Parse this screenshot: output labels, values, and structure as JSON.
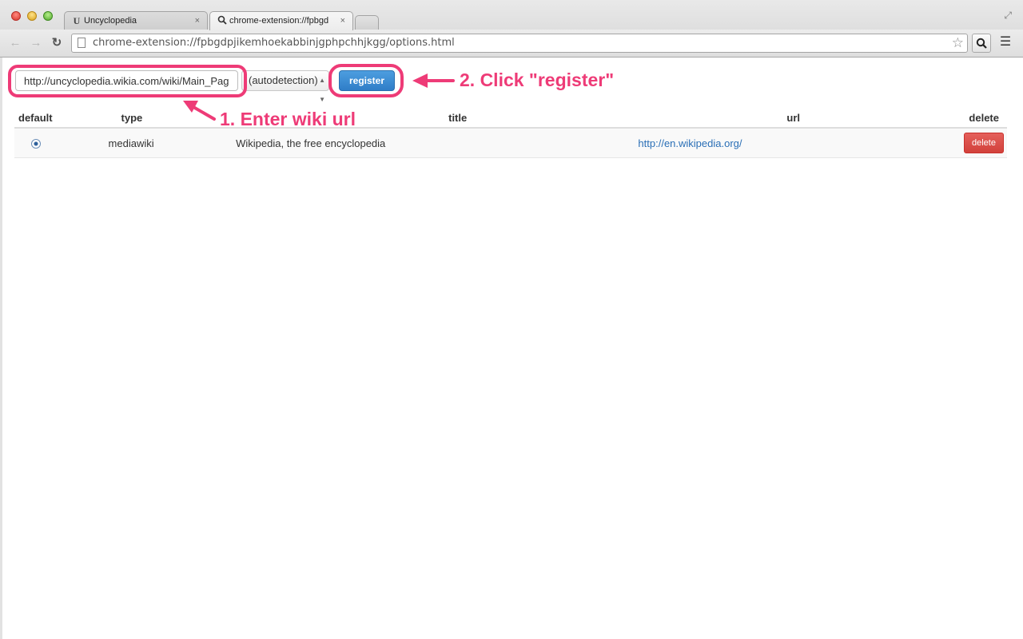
{
  "browser": {
    "tabs": [
      {
        "title": "Uncyclopedia",
        "icon": "U",
        "active": false
      },
      {
        "title": "chrome-extension://fpbgd",
        "icon": "search-icon",
        "active": true
      }
    ],
    "address_bar": "chrome-extension://fpbgdpjikemhoekabbinjgphpchhjkgg/options.html",
    "close_glyph": "×"
  },
  "form": {
    "url_value": "http://uncyclopedia.wikia.com/wiki/Main_Page",
    "type_selected": "(autodetection)",
    "register_label": "register"
  },
  "annotations": {
    "step1": "1. Enter wiki url",
    "step2": "2. Click \"register\"",
    "color": "#ee3b77"
  },
  "table": {
    "headers": {
      "default": "default",
      "type": "type",
      "title": "title",
      "url": "url",
      "delete": "delete"
    },
    "rows": [
      {
        "default_selected": true,
        "type": "mediawiki",
        "title": "Wikipedia, the free encyclopedia",
        "url": "http://en.wikipedia.org/",
        "delete_label": "delete"
      }
    ]
  },
  "colors": {
    "register_button": "#3a87d0",
    "delete_button": "#d9534f",
    "link": "#2a6fb6"
  }
}
